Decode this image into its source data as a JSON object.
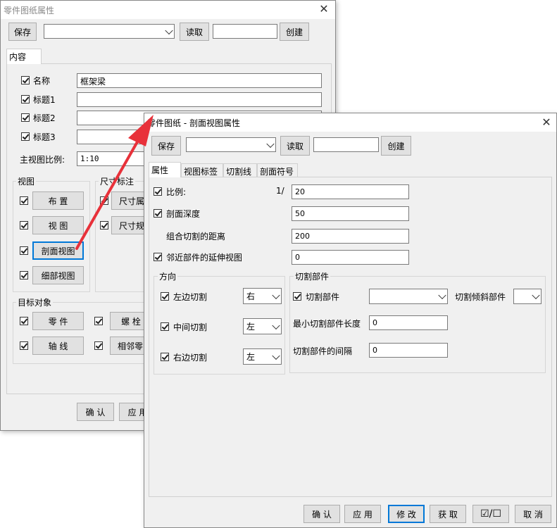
{
  "back": {
    "title": "零件图纸属性",
    "save_label": "保存",
    "read_label": "读取",
    "create_label": "创建",
    "preset_value": "",
    "create_name": "",
    "tab_label": "内容",
    "name_label": "名称",
    "name_value": "框架梁",
    "title1_label": "标题1",
    "title2_label": "标题2",
    "title3_label": "标题3",
    "main_scale_label": "主视图比例:",
    "main_scale_value": "1:10",
    "view_group": "视图",
    "dim_group": "尺寸标注",
    "btn_layout": "布 置",
    "btn_view": "视 图",
    "btn_section": "剖面视图",
    "btn_detail": "细部视图",
    "btn_dim_attr": "尺寸属",
    "btn_dim_rule": "尺寸规",
    "target_group": "目标对象",
    "btn_part": "零 件",
    "btn_bolt": "螺 栓",
    "btn_axis": "轴 线",
    "btn_adjacent": "相邻零",
    "ok_label": "确 认",
    "apply_label": "应 用"
  },
  "front": {
    "title": "零件图纸 - 剖面视图属性",
    "save_label": "保存",
    "read_label": "读取",
    "create_label": "创建",
    "preset_value": "",
    "create_name": "",
    "tabs": [
      "属性",
      "视图标签",
      "切割线",
      "剖面符号"
    ],
    "scale_label": "比例:",
    "scale_prefix": "1/",
    "scale_value": "20",
    "depth_label": "剖面深度",
    "depth_value": "50",
    "combine_label": "组合切割的距离",
    "combine_value": "200",
    "extend_label": "邻近部件的延伸视图",
    "extend_value": "0",
    "direction_group": "方向",
    "left_cut_label": "左边切割",
    "left_cut_value": "右",
    "mid_cut_label": "中间切割",
    "mid_cut_value": "左",
    "right_cut_label": "右边切割",
    "right_cut_value": "左",
    "cutpart_group": "切割部件",
    "cutpart_label": "切割部件",
    "cutpart_value": "",
    "tilt_label": "切割倾斜部件",
    "tilt_value": "",
    "min_len_label": "最小切割部件长度",
    "min_len_value": "0",
    "gap_label": "切割部件的间隔",
    "gap_value": "0",
    "ok_label": "确 认",
    "apply_label": "应 用",
    "modify_label": "修 改",
    "get_label": "获 取",
    "toggle_label": "☑/☐",
    "cancel_label": "取 消"
  },
  "colors": {
    "arrow": "#e8313a",
    "focus": "#0078d7"
  }
}
